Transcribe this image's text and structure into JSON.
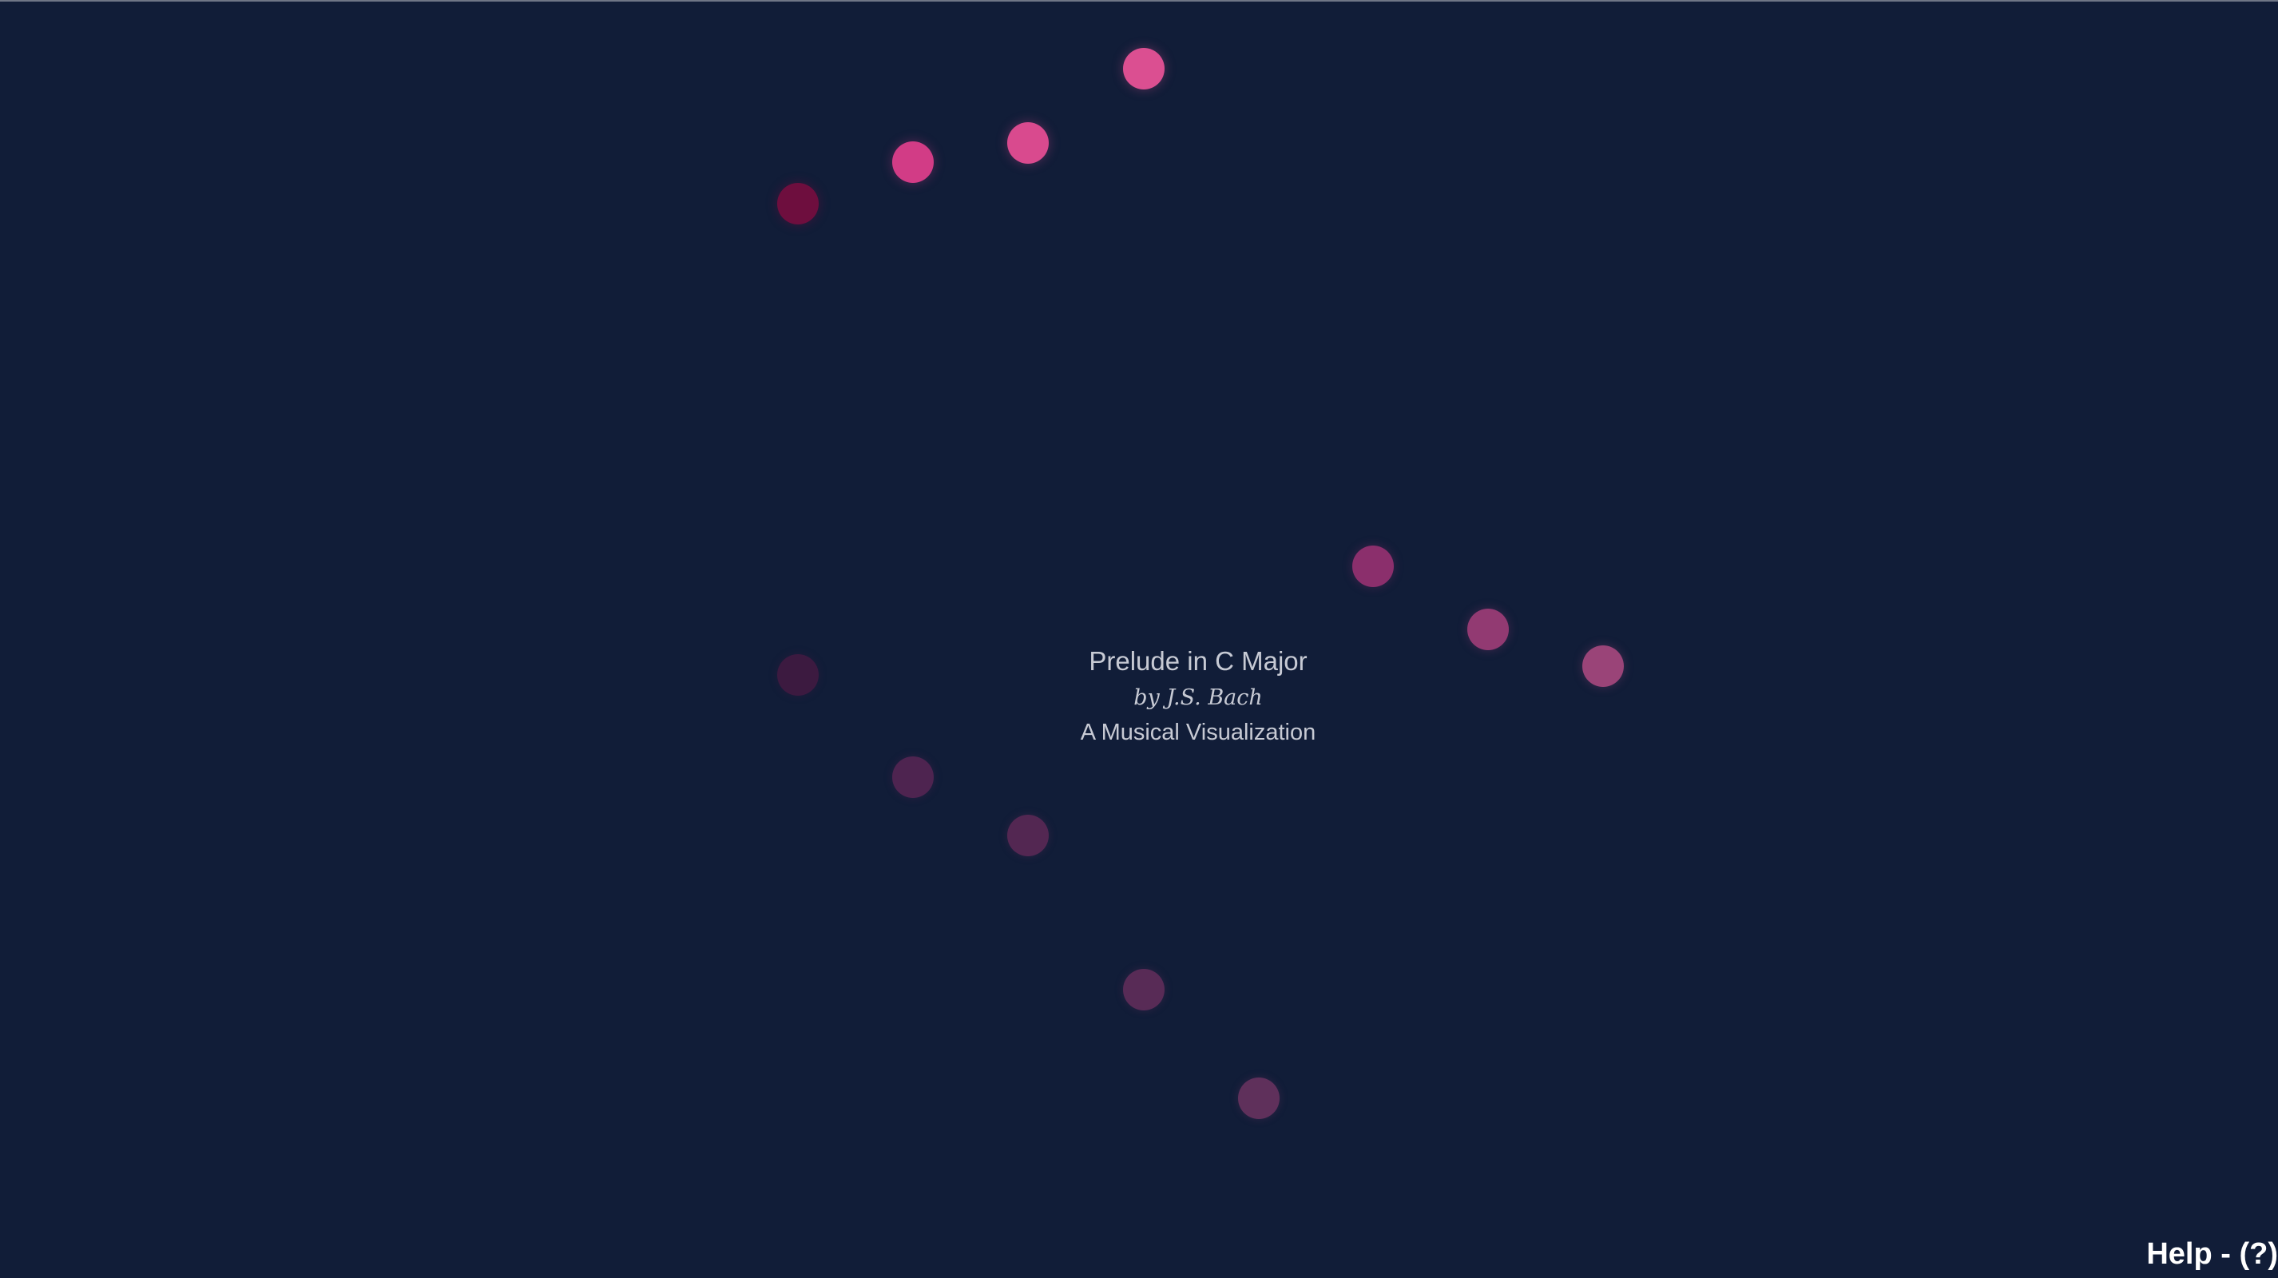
{
  "title": "Prelude in C Major",
  "byline": "by J.S. Bach",
  "subtitle": "A Musical Visualization",
  "help_label": "Help - (?)",
  "colors": {
    "background": "#111d38",
    "text": "#c7cad4",
    "help_text": "#ffffff",
    "active_note": "#d9478f",
    "fading_note": "#7a2a60",
    "current_note": "#6e0e3e"
  }
}
